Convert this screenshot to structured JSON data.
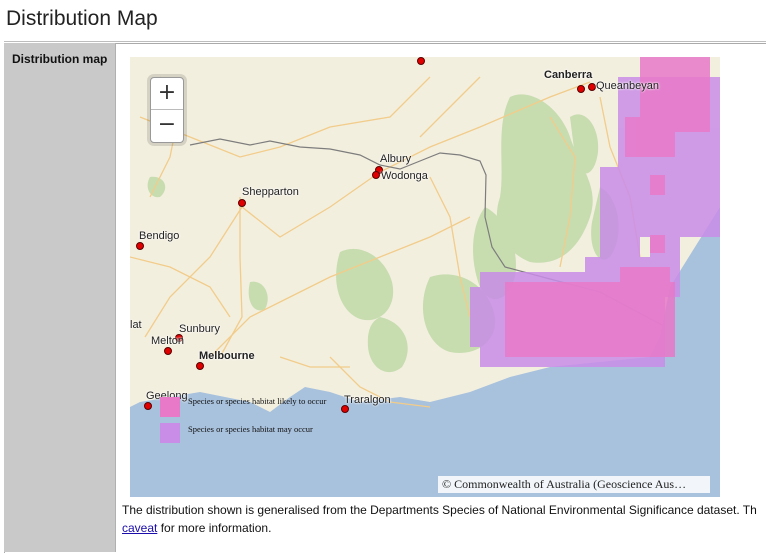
{
  "page": {
    "title": "Distribution Map"
  },
  "sidebar": {
    "label": "Distribution map"
  },
  "map": {
    "zoom_in": "+",
    "zoom_out": "−",
    "cities": {
      "canberra": "Canberra",
      "queanbeyan": "Queanbeyan",
      "albury": "Albury",
      "wodonga": "Wodonga",
      "shepparton": "Shepparton",
      "bendigo": "Bendigo",
      "sunbury": "Sunbury",
      "melton": "Melton",
      "melbourne": "Melbourne",
      "geelong": "Geelong",
      "traralgon": "Traralgon",
      "edge_fragment": "lat"
    },
    "legend": {
      "likely": "Species or species habitat likely to occur",
      "may": "Species or species habitat may occur",
      "likely_color": "#e879c9",
      "may_color": "#c98de8"
    },
    "attribution": "© Commonwealth of Australia (Geoscience Aus…",
    "colors": {
      "land": "#f3efdf",
      "sea": "#a8c1dc",
      "park": "#c7ddb0",
      "road": "#f2cc8a"
    }
  },
  "caption": {
    "text_before": "The distribution shown is generalised from the Departments Species of National Environmental Significance dataset. Th",
    "link": "caveat",
    "text_after": " for more information."
  }
}
